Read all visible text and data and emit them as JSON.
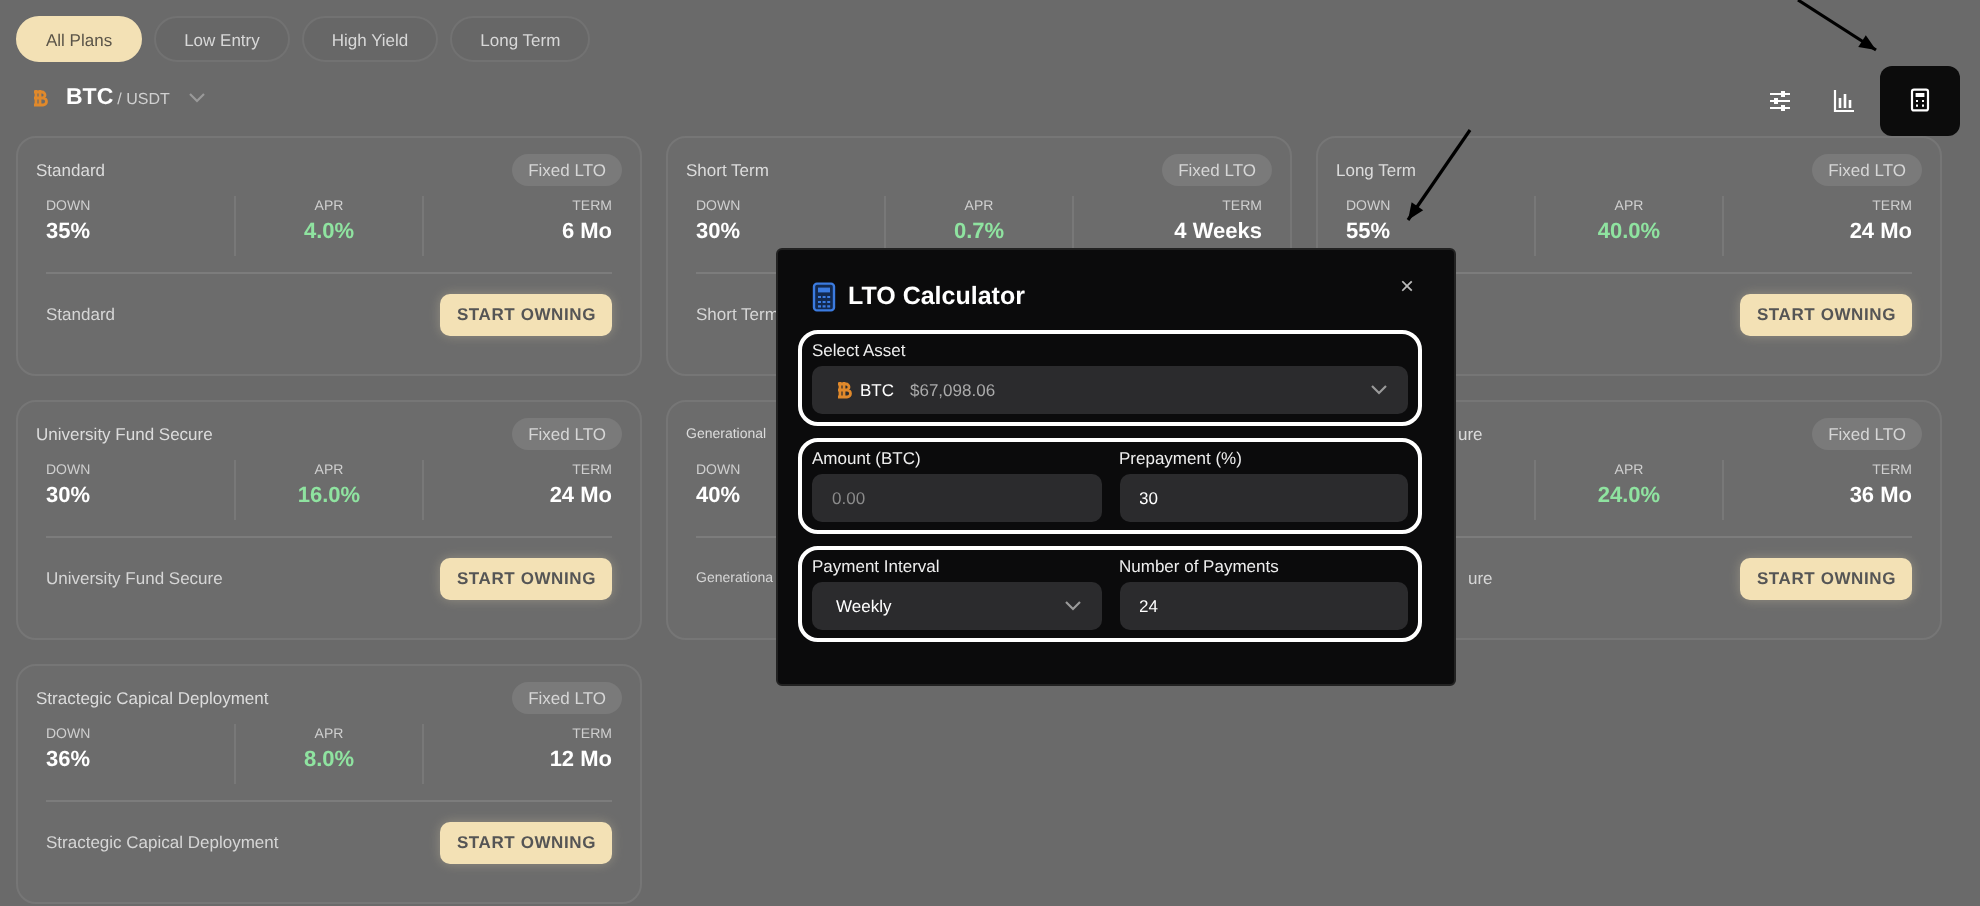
{
  "filters": [
    {
      "label": "All Plans",
      "selected": true
    },
    {
      "label": "Low Entry",
      "selected": false
    },
    {
      "label": "High Yield",
      "selected": false
    },
    {
      "label": "Long Term",
      "selected": false
    }
  ],
  "pair": {
    "base": "BTC",
    "quote": "/ USDT"
  },
  "toolbar": [
    {
      "kind": "filters",
      "selected": false
    },
    {
      "kind": "chart",
      "selected": false
    },
    {
      "kind": "calculator",
      "selected": true
    }
  ],
  "cards": [
    {
      "kind": "full",
      "title": "Standard",
      "badge": "Fixed LTO",
      "stats": [
        {
          "kind": "down",
          "label": "DOWN",
          "value": "35%"
        },
        {
          "kind": "apr",
          "label": "APR",
          "value": "4.0%"
        },
        {
          "kind": "term",
          "label": "TERM",
          "value": "6 Mo"
        }
      ],
      "footer": "Standard",
      "button": "START OWNING"
    },
    {
      "kind": "full",
      "title": "Short Term",
      "badge": "Fixed LTO",
      "stats": [
        {
          "kind": "down",
          "label": "DOWN",
          "value": "30%"
        },
        {
          "kind": "apr",
          "label": "APR",
          "value": "0.7%"
        },
        {
          "kind": "term",
          "label": "TERM",
          "value": "4 Weeks"
        }
      ],
      "footer": "Short Term"
    },
    {
      "kind": "full",
      "title": "Long Term",
      "badge": "Fixed LTO",
      "stats": [
        {
          "kind": "down",
          "label": "DOWN",
          "value": "55%"
        },
        {
          "kind": "apr",
          "label": "APR",
          "value": "40.0%"
        },
        {
          "kind": "term",
          "label": "TERM",
          "value": "24 Mo"
        }
      ],
      "button": "START OWNING"
    },
    {
      "kind": "full",
      "title": "University Fund Secure",
      "badge": "Fixed LTO",
      "stats": [
        {
          "kind": "down",
          "label": "DOWN",
          "value": "30%"
        },
        {
          "kind": "apr",
          "label": "APR",
          "value": "16.0%"
        },
        {
          "kind": "term",
          "label": "TERM",
          "value": "24 Mo"
        }
      ],
      "footer": "University Fund Secure",
      "button": "START OWNING"
    },
    {
      "kind": "cutoff",
      "title": "Generational",
      "stats": [
        {
          "kind": "down",
          "label": "DOWN",
          "value": "40%"
        }
      ],
      "footer": "Generationa"
    },
    {
      "kind": "peek",
      "title": "ure",
      "badge": "Fixed LTO",
      "stats": [
        {
          "kind": "apr",
          "label": "APR",
          "value": "24.0%"
        },
        {
          "kind": "term",
          "label": "TERM",
          "value": "36 Mo"
        }
      ],
      "footer": "ure",
      "button": "START OWNING"
    },
    {
      "kind": "full",
      "title": "Stractegic Capical Deployment",
      "badge": "Fixed LTO",
      "stats": [
        {
          "kind": "down",
          "label": "DOWN",
          "value": "36%"
        },
        {
          "kind": "apr",
          "label": "APR",
          "value": "8.0%"
        },
        {
          "kind": "term",
          "label": "TERM",
          "value": "12 Mo"
        }
      ],
      "footer": "Stractegic Capical Deployment",
      "button": "START OWNING"
    }
  ],
  "modal": {
    "title": "LTO Calculator",
    "close": "×",
    "groups": [
      {
        "fields": [
          {
            "kind": "asset",
            "label": "Select Asset",
            "value": "BTC",
            "price": "$67,098.06"
          }
        ]
      },
      {
        "fields": [
          {
            "kind": "input",
            "label": "Amount (BTC)",
            "placeholder": "0.00"
          },
          {
            "kind": "input",
            "label": "Prepayment (%)",
            "value": "30"
          }
        ]
      },
      {
        "fields": [
          {
            "kind": "select",
            "label": "Payment Interval",
            "value": "Weekly"
          },
          {
            "kind": "input",
            "label": "Number of Payments",
            "value": "24"
          }
        ]
      }
    ]
  }
}
